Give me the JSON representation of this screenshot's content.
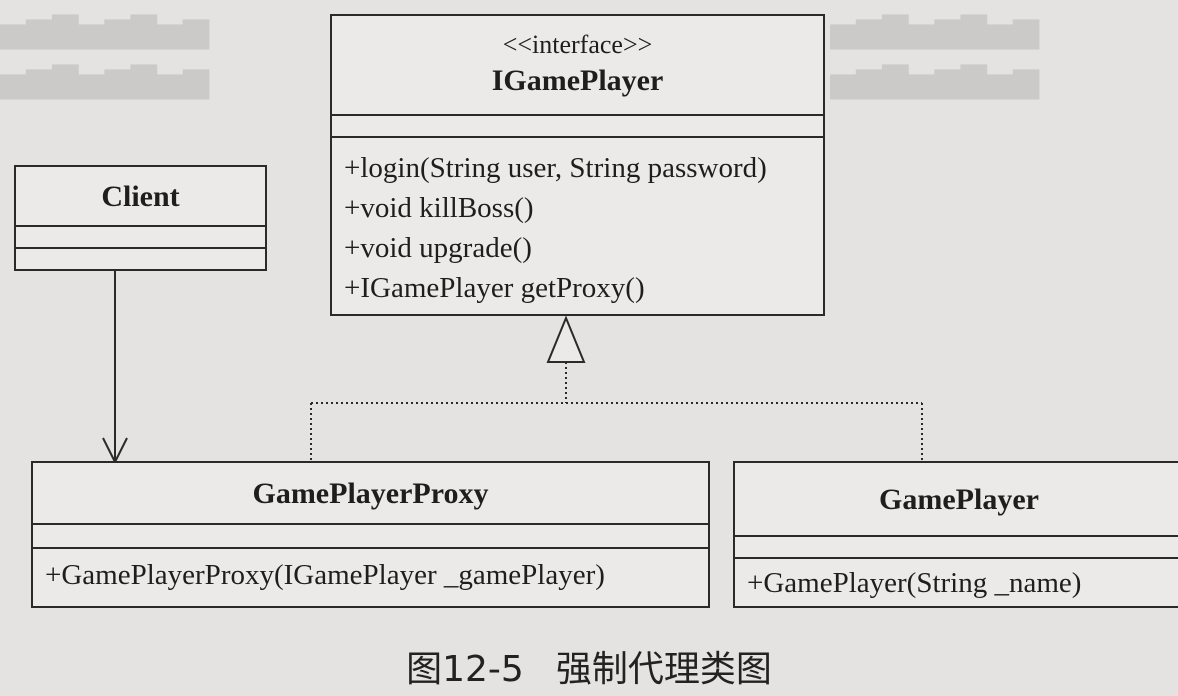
{
  "interface": {
    "stereotype": "<<interface>>",
    "name": "IGamePlayer",
    "operations": [
      "+login(String user, String password)",
      "+void killBoss()",
      "+void upgrade()",
      "+IGamePlayer getProxy()"
    ]
  },
  "client": {
    "name": "Client"
  },
  "proxy": {
    "name": "GamePlayerProxy",
    "operations": [
      "+GamePlayerProxy(IGamePlayer _gamePlayer)"
    ]
  },
  "player": {
    "name": "GamePlayer",
    "operations": [
      "+GamePlayer(String _name)"
    ]
  },
  "caption": {
    "figure": "图12-5",
    "title": "强制代理类图"
  }
}
